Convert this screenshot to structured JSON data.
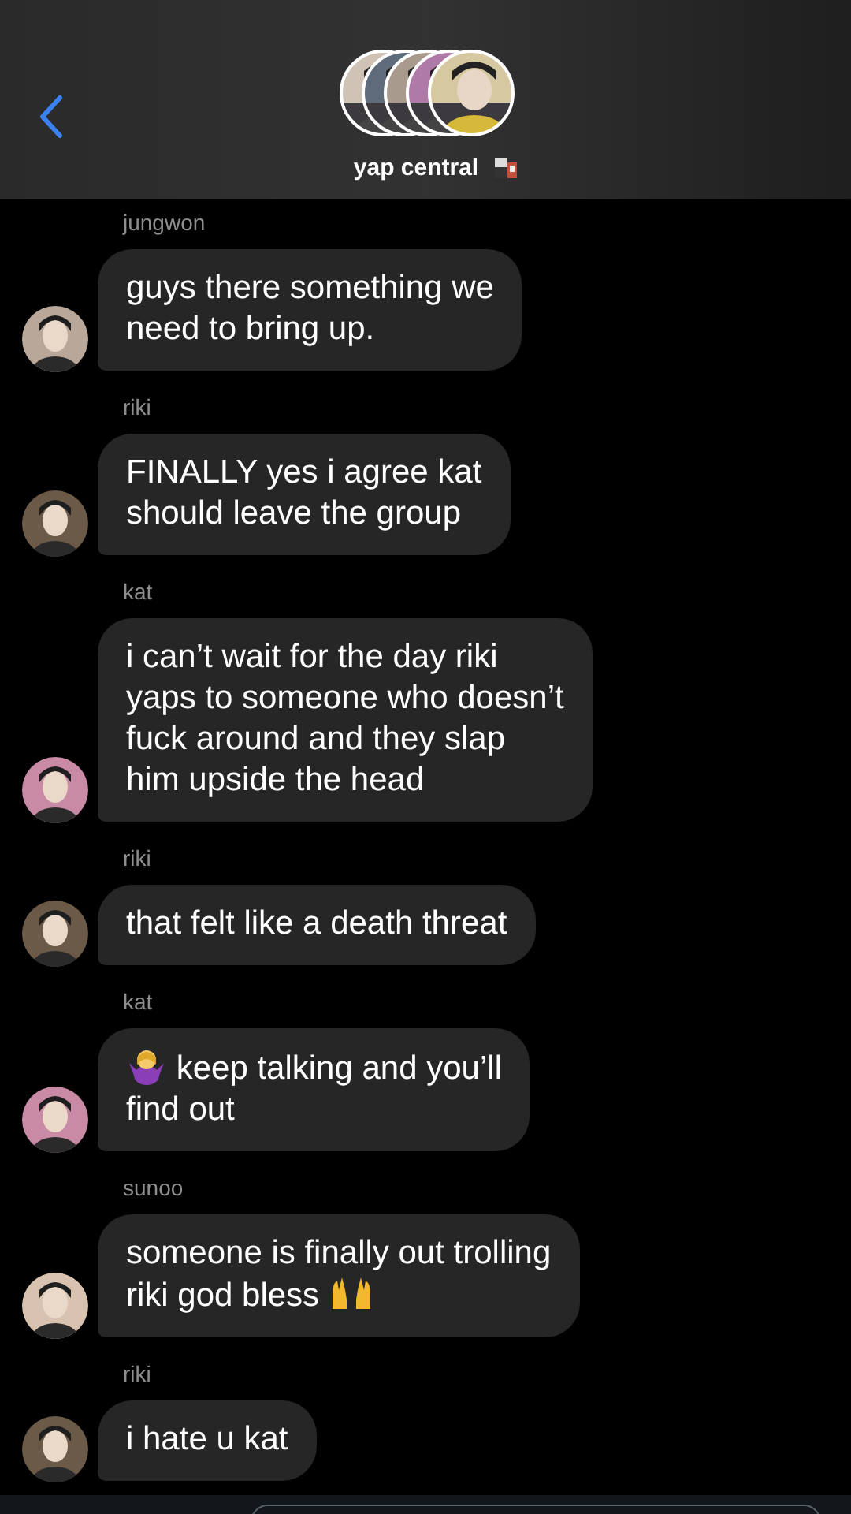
{
  "header": {
    "title": "yap central"
  },
  "messages": [
    {
      "sender": "jungwon",
      "kind": "text",
      "lines": [
        "guys there something we",
        "need to bring up."
      ]
    },
    {
      "sender": "riki",
      "kind": "text",
      "lines": [
        "FINALLY yes i agree kat",
        "should leave the group"
      ]
    },
    {
      "sender": "kat",
      "kind": "text",
      "lines": [
        "i can’t wait for the day riki",
        "yaps to someone who doesn’t",
        "fuck around and they slap",
        "him upside the head"
      ]
    },
    {
      "sender": "riki",
      "kind": "text",
      "lines": [
        "that felt like a death threat"
      ]
    },
    {
      "sender": "kat",
      "kind": "lead_emoji",
      "lines": [
        "keep talking and you’ll",
        "find out"
      ]
    },
    {
      "sender": "sunoo",
      "kind": "trail_emoji",
      "lines": [
        "someone is finally out trolling",
        "riki god bless"
      ]
    },
    {
      "sender": "riki",
      "kind": "text",
      "lines": [
        "i hate u kat"
      ]
    }
  ]
}
